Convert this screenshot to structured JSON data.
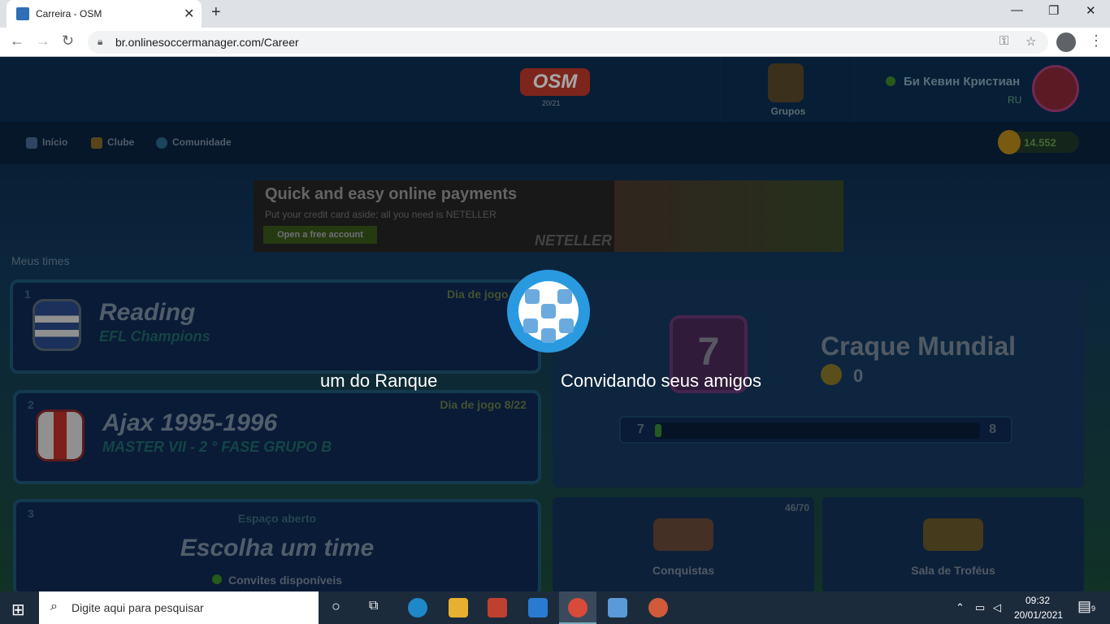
{
  "browser": {
    "tab_title": "Carreira - OSM",
    "url": "br.onlinesoccermanager.com/Career",
    "close_label": "✕",
    "new_tab_label": "+",
    "minimize_label": "—",
    "restore_label": "❐",
    "window_close_label": "✕"
  },
  "header": {
    "logo": "OSM",
    "season": "20/21",
    "groups_label": "Grupos",
    "user_name": "Би Кевин Кристиан",
    "user_country": "RU"
  },
  "nav": {
    "items": [
      "Início",
      "Clube",
      "Comunidade"
    ],
    "coins": "14.552"
  },
  "ad": {
    "title": "Quick and easy online payments",
    "subtitle": "Put your credit card aside; all you need is NETELLER",
    "button": "Open a free account",
    "brand": "NETELLER"
  },
  "main": {
    "section_label": "Meus times",
    "teams": [
      {
        "number": "1",
        "name": "Reading",
        "league": "EFL Champions",
        "matchday": "Dia de jogo 11/"
      },
      {
        "number": "2",
        "name": "Ajax 1995-1996",
        "league": "MASTER VII - 2 ° FASE GRUPO B",
        "matchday": "Dia de jogo 8/22"
      },
      {
        "number": "3",
        "name": "Escolha um time",
        "status": "Espaço aberto",
        "invites": "Convites disponíveis"
      }
    ],
    "rank": {
      "level": "7",
      "title": "Craque Mundial",
      "points": "0",
      "progress_from": "7",
      "progress_to": "8",
      "progress_fraction": 0.02
    },
    "achievements": {
      "label": "Conquistas",
      "count": "46/70"
    },
    "trophies": {
      "label": "Sala de Troféus"
    }
  },
  "overlay": {
    "left_text": "um do Ranque",
    "right_text": "Convidando seus amigos"
  },
  "taskbar": {
    "search_placeholder": "Digite aqui para pesquisar",
    "time": "09:32",
    "date": "20/01/2021",
    "notifications": "9"
  },
  "colors": {
    "accent_blue": "#2a9ae0",
    "page_bg": "#0b2a4a"
  }
}
